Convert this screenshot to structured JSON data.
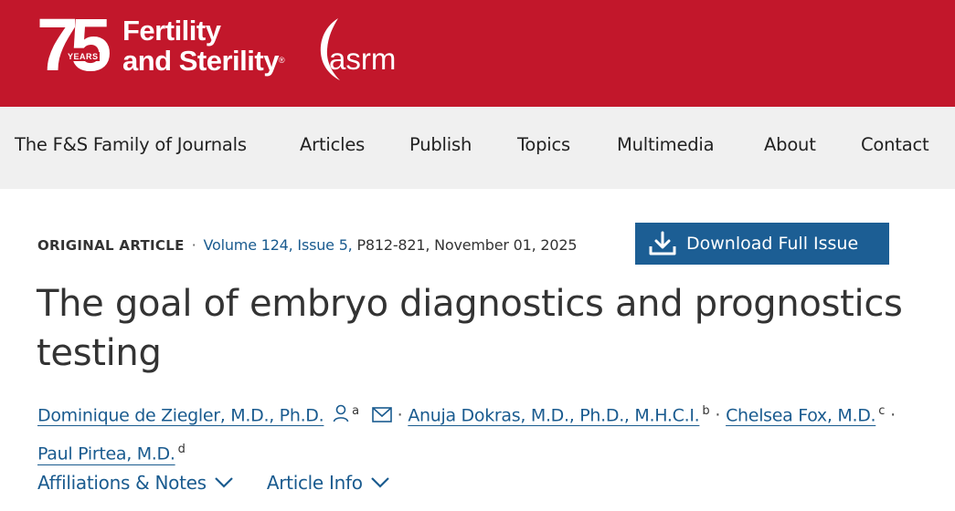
{
  "header": {
    "anniversary_number": "75",
    "anniversary_years": "YEARS",
    "journal_line1": "Fertility",
    "journal_line2": "and Sterility",
    "trademark": "®",
    "partner_logo_text": "asrm",
    "background_color": "#c2172b"
  },
  "nav": {
    "items": [
      {
        "label": "The F&S Family of Journals"
      },
      {
        "label": "Articles"
      },
      {
        "label": "Publish"
      },
      {
        "label": "Topics"
      },
      {
        "label": "Multimedia"
      },
      {
        "label": "About"
      },
      {
        "label": "Contact"
      }
    ]
  },
  "article": {
    "type": "ORIGINAL ARTICLE",
    "separator": "·",
    "volume_issue": "Volume 124, Issue 5,",
    "pages_date": " P812-821, November 01, 2025",
    "title": "The goal of embryo diagnostics and prognostics testing",
    "download_label": "Download Full Issue",
    "authors": [
      {
        "name": "Dominique de Ziegler, M.D., Ph.D.",
        "sup": "a"
      },
      {
        "name": "Anuja Dokras, M.D., Ph.D., M.H.C.I.",
        "sup": "b"
      },
      {
        "name": "Chelsea Fox, M.D.",
        "sup": "c"
      },
      {
        "name": "Paul Pirtea, M.D.",
        "sup": "d"
      }
    ],
    "author_separator": "·",
    "toggles": [
      {
        "label": "Affiliations & Notes"
      },
      {
        "label": "Article Info"
      }
    ]
  },
  "colors": {
    "brand_red": "#c2172b",
    "link_blue": "#1a5b8f",
    "button_blue": "#1c5e94",
    "nav_bg": "#f0f0f0"
  }
}
